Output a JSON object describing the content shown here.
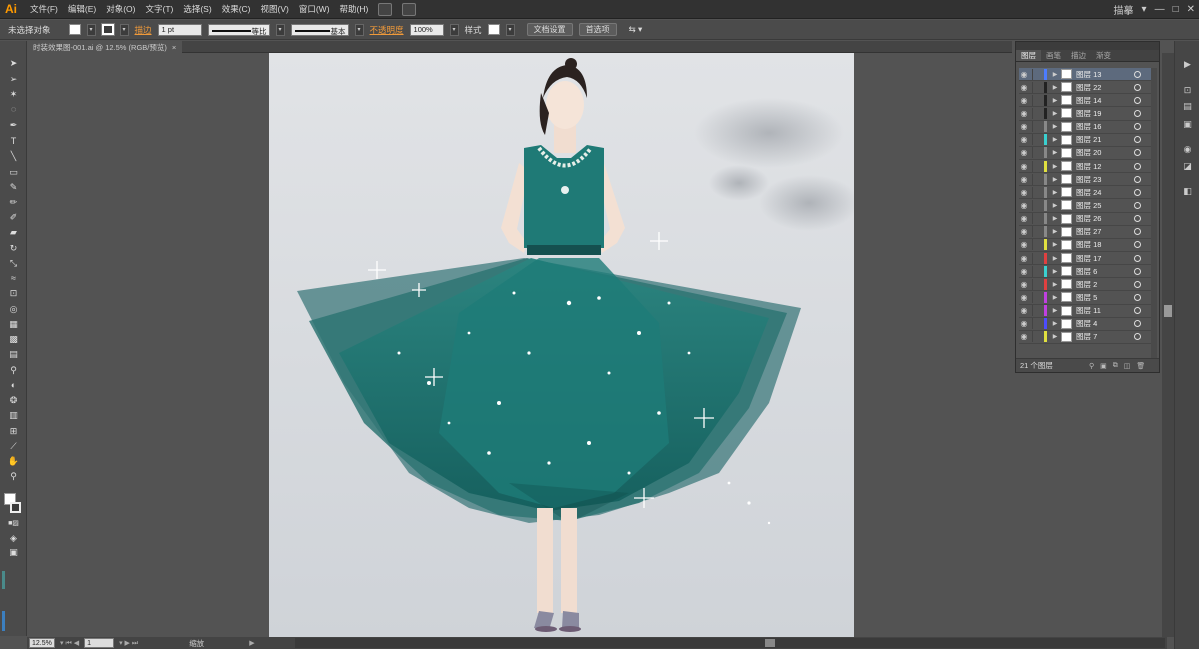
{
  "app": {
    "logo": "Ai"
  },
  "menu": [
    "文件(F)",
    "编辑(E)",
    "对象(O)",
    "文字(T)",
    "选择(S)",
    "效果(C)",
    "视图(V)",
    "窗口(W)",
    "帮助(H)"
  ],
  "window": {
    "workspace": "描摹",
    "workspace_arrow": "▾",
    "minimize": "—",
    "maximize": "□",
    "close": "✕"
  },
  "controlbar": {
    "selection": "未选择对象",
    "stroke_label": "描边",
    "stroke_weight": "1 pt",
    "profile_label": "等比",
    "brush_label": "基本",
    "opacity_label": "不透明度",
    "opacity_value": "100%",
    "style_label": "样式",
    "doc_setup": "文档设置",
    "preferences": "首选项"
  },
  "document": {
    "tab_title": "时装效果图-001.ai @ 12.5% (RGB/预览)",
    "tab_close": "×"
  },
  "status": {
    "zoom": "12.5%",
    "page": "1",
    "info": "缩放"
  },
  "layers_panel": {
    "tabs": [
      "图层",
      "画笔",
      "描边",
      "渐变"
    ],
    "count_text": "21 个图层",
    "layers": [
      {
        "name": "图层 13",
        "color": "#4c7cff",
        "selected": true
      },
      {
        "name": "图层 22",
        "color": "#222222"
      },
      {
        "name": "图层 14",
        "color": "#222222"
      },
      {
        "name": "图层 19",
        "color": "#222222"
      },
      {
        "name": "图层 16",
        "color": "#888888"
      },
      {
        "name": "图层 21",
        "color": "#3ad0d0"
      },
      {
        "name": "图层 20",
        "color": "#888888"
      },
      {
        "name": "图层 12",
        "color": "#e0e040"
      },
      {
        "name": "图层 23",
        "color": "#888888"
      },
      {
        "name": "图层 24",
        "color": "#888888"
      },
      {
        "name": "图层 25",
        "color": "#888888"
      },
      {
        "name": "图层 26",
        "color": "#888888"
      },
      {
        "name": "图层 27",
        "color": "#888888"
      },
      {
        "name": "图层 18",
        "color": "#e0e040"
      },
      {
        "name": "图层 17",
        "color": "#e04040"
      },
      {
        "name": "图层 6",
        "color": "#3ad0d0"
      },
      {
        "name": "图层 2",
        "color": "#e04040"
      },
      {
        "name": "图层 5",
        "color": "#c040e0"
      },
      {
        "name": "图层 11",
        "color": "#c040e0"
      },
      {
        "name": "图层 4",
        "color": "#4c4cff"
      },
      {
        "name": "图层 7",
        "color": "#e0e040"
      }
    ]
  },
  "colors": {
    "dress": "#1e7c78",
    "dress_dark": "#175e5c",
    "accent": "#f09a3a"
  }
}
